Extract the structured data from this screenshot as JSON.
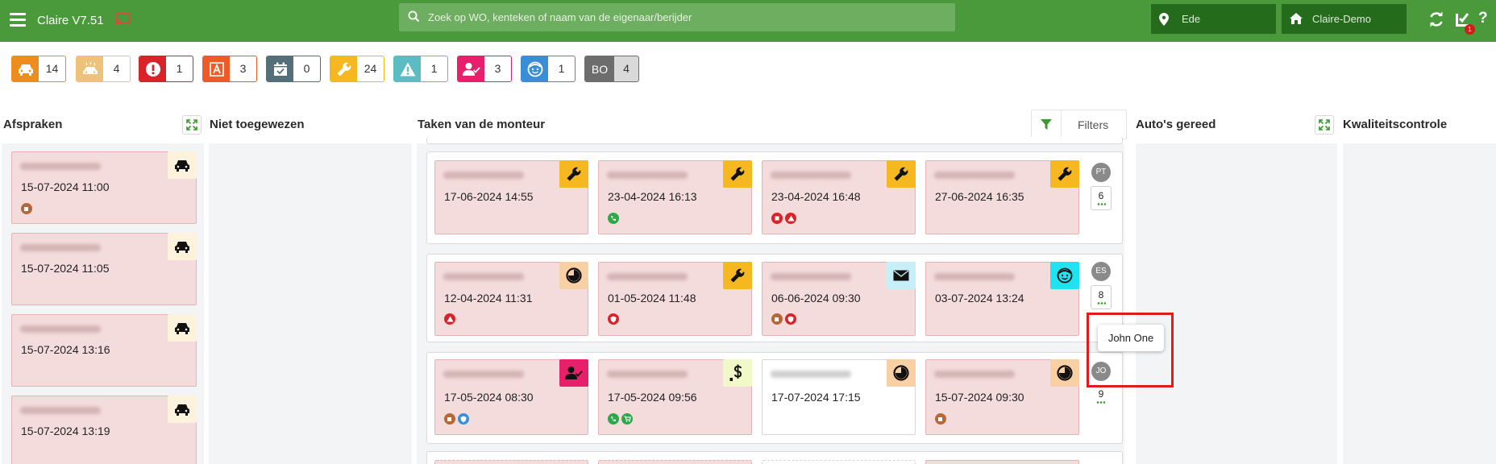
{
  "header": {
    "app_title": "Claire V7.51",
    "search_placeholder": "Zoek op WO, kenteken of naam van de eigenaar/berijder",
    "location": "Ede",
    "company": "Claire-Demo",
    "notification_count": "1"
  },
  "status_chips": [
    {
      "icon": "car-icon",
      "count": "14",
      "color": "#ef8c1e"
    },
    {
      "icon": "car-wash-icon",
      "count": "4",
      "color": "#efc27a"
    },
    {
      "icon": "alert-circle-icon",
      "count": "1",
      "color": "#d8232a"
    },
    {
      "icon": "letter-a-icon",
      "count": "3",
      "color": "#f05a24"
    },
    {
      "icon": "calendar-check-icon",
      "count": "0",
      "color": "#546e7a"
    },
    {
      "icon": "wrench-icon",
      "count": "24",
      "color": "#f5b820"
    },
    {
      "icon": "warning-triangle-icon",
      "count": "1",
      "color": "#5cbcc4"
    },
    {
      "icon": "user-check-icon",
      "count": "3",
      "color": "#e8206b"
    },
    {
      "icon": "face-icon",
      "count": "1",
      "color": "#3a8ed8"
    },
    {
      "icon": "bo-label",
      "label": "BO",
      "count": "4",
      "color": "#6d6d6d"
    }
  ],
  "columns": {
    "afspraken": "Afspraken",
    "niet_toegewezen": "Niet toegewezen",
    "taken": "Taken van de monteur",
    "filters_label": "Filters",
    "gereed": "Auto's gereed",
    "kwaliteit": "Kwaliteitscontrole"
  },
  "appointments": [
    {
      "datetime": "15-07-2024 11:00"
    },
    {
      "datetime": "15-07-2024 11:05"
    },
    {
      "datetime": "15-07-2024 13:16"
    },
    {
      "datetime": "15-07-2024 13:19"
    }
  ],
  "mechanics": [
    {
      "initials": "PT",
      "count": "6",
      "tasks": [
        {
          "datetime": "17-06-2024 14:55"
        },
        {
          "datetime": "23-04-2024 16:13"
        },
        {
          "datetime": "23-04-2024 16:48"
        },
        {
          "datetime": "27-06-2024 16:35"
        }
      ]
    },
    {
      "initials": "ES",
      "count": "8",
      "tasks": [
        {
          "datetime": "12-04-2024 11:31"
        },
        {
          "datetime": "01-05-2024 11:48"
        },
        {
          "datetime": "06-06-2024 09:30"
        },
        {
          "datetime": "03-07-2024 13:24"
        }
      ]
    },
    {
      "initials": "JO",
      "count": "9",
      "tooltip": "John One",
      "tasks": [
        {
          "datetime": "17-05-2024 08:30"
        },
        {
          "datetime": "17-05-2024 09:56"
        },
        {
          "datetime": "17-07-2024 17:15"
        },
        {
          "datetime": "15-07-2024 09:30"
        }
      ]
    }
  ]
}
